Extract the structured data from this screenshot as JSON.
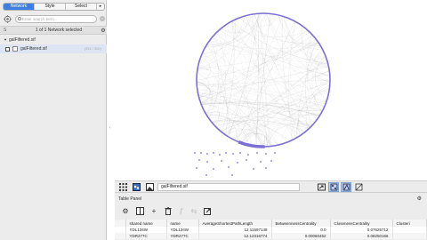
{
  "left_panel": {
    "tabs": [
      "Network",
      "Style",
      "Select"
    ],
    "tab_more": "▸",
    "search_placeholder": "Enter search term...",
    "network_share_label": "S",
    "network_count": "1 of 1 Network selected",
    "tree_root": "galFiltered.sif",
    "tree_child": "galFiltered.sif",
    "tree_child_count": "(331 / 362)"
  },
  "toolbar": {
    "view_title": "galFiltered.sif"
  },
  "table_panel": {
    "title": "Table Panel",
    "columns": [
      "",
      "shared name",
      "name",
      "AverageShortestPathLength",
      "BetweennessCentrality",
      "ClosenessCentrality",
      "Clusteri"
    ],
    "rows": [
      [
        "",
        "YDL134W",
        "YDL134W",
        "12.11597148",
        "0.0",
        "0.07625712",
        ""
      ],
      [
        "",
        "YDR277C",
        "YDR277C",
        "12.12316774",
        "0.00060452",
        "0.08250166",
        ""
      ]
    ]
  },
  "colors": {
    "accent": "#3d7fe0",
    "node": "#7b6fd4",
    "edge": "#999999"
  }
}
